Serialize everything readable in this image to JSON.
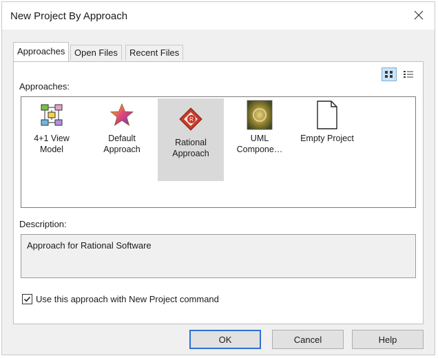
{
  "window": {
    "title": "New Project By Approach"
  },
  "tabs": [
    {
      "label": "Approaches",
      "active": true
    },
    {
      "label": "Open Files",
      "active": false
    },
    {
      "label": "Recent Files",
      "active": false
    }
  ],
  "view_buttons": [
    {
      "name": "large-icons-view",
      "selected": true
    },
    {
      "name": "details-view",
      "selected": false
    }
  ],
  "approaches_label": "Approaches:",
  "approaches": [
    {
      "line1": "4+1 View",
      "line2": "Model",
      "icon": "grid-model-icon"
    },
    {
      "line1": "Default",
      "line2": "Approach",
      "icon": "star-icon"
    },
    {
      "line1": "Rational",
      "line2": "Approach",
      "icon": "rational-diamond-icon",
      "selected": true
    },
    {
      "line1": "UML",
      "line2": "Compone…",
      "icon": "uml-component-icon"
    },
    {
      "line1": "Empty Project",
      "line2": "",
      "icon": "blank-page-icon"
    }
  ],
  "description_label": "Description:",
  "description_text": "Approach for Rational Software",
  "checkbox": {
    "label": "Use this approach with New Project command",
    "checked": true
  },
  "buttons": {
    "ok": "OK",
    "cancel": "Cancel",
    "help": "Help"
  },
  "colors": {
    "selection": "#d9d9d9",
    "dialog_bg": "#f0f0f0",
    "default_button_border": "#2b6fd6"
  }
}
